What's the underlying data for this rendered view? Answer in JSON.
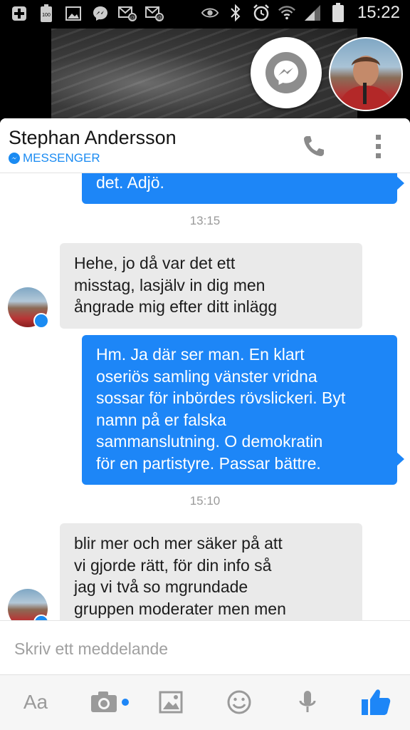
{
  "status_bar": {
    "time": "15:22",
    "left_icons": [
      "plus-icon",
      "battery-100-icon",
      "image-icon",
      "messenger-icon",
      "mail-icon",
      "mail-icon"
    ],
    "right_icons": [
      "eye-icon",
      "bluetooth-icon",
      "alarm-icon",
      "wifi-icon",
      "signal-icon",
      "battery-icon"
    ]
  },
  "conversation": {
    "contact_name": "Stephan Andersson",
    "app_label": "MESSENGER"
  },
  "messages": [
    {
      "type": "outgoing",
      "text": "det.  Adjö."
    },
    {
      "type": "time",
      "text": "13:15"
    },
    {
      "type": "incoming",
      "lines": [
        "Hehe, jo då var det ett",
        "misstag, lasjälv in dig men",
        "ångrade mig efter ditt inlägg"
      ]
    },
    {
      "type": "outgoing",
      "lines": [
        "Hm. Ja där ser man.  En klart",
        "oseriös samling vänster vridna",
        "sossar för inbördes rövslickeri. Byt",
        "namn på er falska",
        "sammanslutning.  O demokratin",
        "för en partistyre.  Passar bättre."
      ]
    },
    {
      "type": "time",
      "text": "15:10"
    },
    {
      "type": "incoming",
      "lines": [
        "blir mer och mer säker på att",
        "vi gjorde rätt, för din info så",
        "jag vi två so mgrundade",
        "gruppen moderater men men"
      ]
    }
  ],
  "composer": {
    "placeholder": "Skriv ett meddelande"
  },
  "toolbar": {
    "text_label": "Aa",
    "icons": [
      "camera-icon",
      "image-icon",
      "emoji-icon",
      "microphone-icon",
      "thumbs-up-icon"
    ]
  },
  "colors": {
    "accent": "#1d86f7",
    "incoming_bubble": "#eaeaea"
  }
}
